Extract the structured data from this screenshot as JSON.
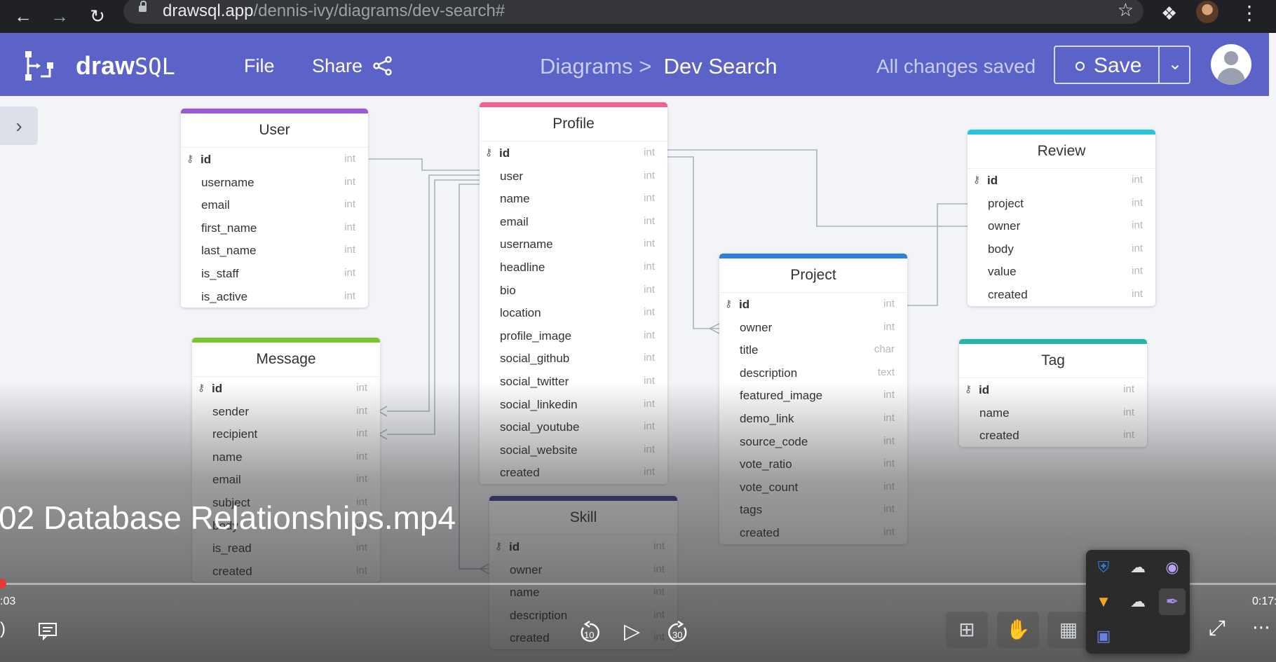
{
  "browser": {
    "url_host": "drawsql.app",
    "url_path": "/dennis-ivy/diagrams/dev-search#"
  },
  "app": {
    "brand_bold": "draw",
    "brand_light": "SQL",
    "menu_file": "File",
    "menu_share": "Share",
    "breadcrumb_parent": "Diagrams >",
    "breadcrumb_current": "Dev Search",
    "status": "All changes saved",
    "save_label": "Save"
  },
  "tables": {
    "user": {
      "name": "User",
      "color": "#9b59d6",
      "rows": [
        {
          "f": "id",
          "t": "int"
        },
        {
          "f": "username",
          "t": "int"
        },
        {
          "f": "email",
          "t": "int"
        },
        {
          "f": "first_name",
          "t": "int"
        },
        {
          "f": "last_name",
          "t": "int"
        },
        {
          "f": "is_staff",
          "t": "int"
        },
        {
          "f": "is_active",
          "t": "int"
        }
      ]
    },
    "profile": {
      "name": "Profile",
      "color": "#f06292",
      "rows": [
        {
          "f": "id",
          "t": "int"
        },
        {
          "f": "user",
          "t": "int"
        },
        {
          "f": "name",
          "t": "int"
        },
        {
          "f": "email",
          "t": "int"
        },
        {
          "f": "username",
          "t": "int"
        },
        {
          "f": "headline",
          "t": "int"
        },
        {
          "f": "bio",
          "t": "int"
        },
        {
          "f": "location",
          "t": "int"
        },
        {
          "f": "profile_image",
          "t": "int"
        },
        {
          "f": "social_github",
          "t": "int"
        },
        {
          "f": "social_twitter",
          "t": "int"
        },
        {
          "f": "social_linkedin",
          "t": "int"
        },
        {
          "f": "social_youtube",
          "t": "int"
        },
        {
          "f": "social_website",
          "t": "int"
        },
        {
          "f": "created",
          "t": "int"
        }
      ]
    },
    "review": {
      "name": "Review",
      "color": "#26c6da",
      "rows": [
        {
          "f": "id",
          "t": "int"
        },
        {
          "f": "project",
          "t": "int"
        },
        {
          "f": "owner",
          "t": "int"
        },
        {
          "f": "body",
          "t": "int"
        },
        {
          "f": "value",
          "t": "int"
        },
        {
          "f": "created",
          "t": "int"
        }
      ]
    },
    "project": {
      "name": "Project",
      "color": "#2f7fd8",
      "rows": [
        {
          "f": "id",
          "t": "int"
        },
        {
          "f": "owner",
          "t": "int"
        },
        {
          "f": "title",
          "t": "char"
        },
        {
          "f": "description",
          "t": "text"
        },
        {
          "f": "featured_image",
          "t": "int"
        },
        {
          "f": "demo_link",
          "t": "int"
        },
        {
          "f": "source_code",
          "t": "int"
        },
        {
          "f": "vote_ratio",
          "t": "int"
        },
        {
          "f": "vote_count",
          "t": "int"
        },
        {
          "f": "tags",
          "t": "int"
        },
        {
          "f": "created",
          "t": "int"
        }
      ]
    },
    "message": {
      "name": "Message",
      "color": "#7cc62d",
      "rows": [
        {
          "f": "id",
          "t": "int"
        },
        {
          "f": "sender",
          "t": "int"
        },
        {
          "f": "recipient",
          "t": "int"
        },
        {
          "f": "name",
          "t": "int"
        },
        {
          "f": "email",
          "t": "int"
        },
        {
          "f": "subject",
          "t": "int"
        },
        {
          "f": "body",
          "t": "int"
        },
        {
          "f": "is_read",
          "t": "int"
        },
        {
          "f": "created",
          "t": "int"
        }
      ]
    },
    "tag": {
      "name": "Tag",
      "color": "#26b5a8",
      "rows": [
        {
          "f": "id",
          "t": "int"
        },
        {
          "f": "name",
          "t": "int"
        },
        {
          "f": "created",
          "t": "int"
        }
      ]
    },
    "skill": {
      "name": "Skill",
      "color": "#3f3d8f",
      "rows": [
        {
          "f": "id",
          "t": "int"
        },
        {
          "f": "owner",
          "t": "int"
        },
        {
          "f": "name",
          "t": "int"
        },
        {
          "f": "description",
          "t": "int"
        },
        {
          "f": "created",
          "t": "int"
        }
      ]
    }
  },
  "video": {
    "title": "02 Database Relationships.mp4",
    "time_current": ":03",
    "time_total": "0:17:",
    "skip_back": "10",
    "skip_forward": "30",
    "progress_fraction": 0.0
  }
}
